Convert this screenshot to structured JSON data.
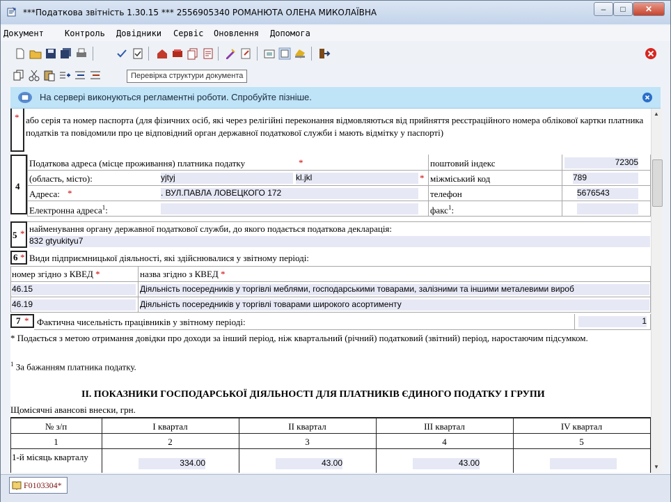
{
  "window": {
    "title": "***Податкова звітність 1.30.15 *** 2556905340 РОМАНЮТА ОЛЕНА МИКОЛАЇВНА",
    "controls": {
      "minimize": "–",
      "maximize": "□",
      "close": "✕"
    }
  },
  "menu": [
    "Документ",
    "Контроль",
    "Довідники",
    "Сервіс",
    "Оновлення",
    "Допомога"
  ],
  "toolbar": {
    "tooltip": "Перевірка структури документа",
    "icons": [
      "new-icon",
      "open-icon",
      "save-icon",
      "save-all-icon",
      "print-icon",
      "check-icon",
      "verify-structure-icon",
      "home-icon",
      "books-icon",
      "copy-doc-icon",
      "report-icon",
      "sign-icon",
      "export-icon",
      "settings-icon",
      "view-icon",
      "help-icon",
      "exit-icon",
      "stop-icon"
    ],
    "row2_icons": [
      "copy-icon",
      "cut-icon",
      "paste-icon",
      "add-row-icon",
      "insert-row-icon",
      "delete-row-icon"
    ]
  },
  "notice": {
    "text": "На сервері виконуються регламентні роботи. Спробуйте пізніше."
  },
  "doc": {
    "passport_note": "або серія та номер паспорта (для фізичних осіб, які через релігійні переконання відмовляються від прийняття реєстраційного номера облікової картки платника податків та повідомили про це відповідний орган державної податкової служби і мають відмітку у паспорті)",
    "s4": {
      "num": "4",
      "address_label": "Податкова адреса (місце проживання) платника податку",
      "region_label": "(область, місто):",
      "region_value": "yjtyj",
      "city_value": "kl.jkl",
      "street_label": "Адреса:",
      "street_value": ". ВУЛ.ПАВЛА ЛОВЕЦКОГО 172",
      "email_label": "Електронна адреса",
      "email_sup": "1",
      "email_value": "",
      "postal_label": "поштовий індекс",
      "postal_value": "72305",
      "intercity_label": "міжміський код",
      "intercity_value": "789",
      "phone_label": "телефон",
      "phone_value": "5676543",
      "fax_label": "факс",
      "fax_sup": "1",
      "fax_value": ""
    },
    "s5": {
      "num": "5",
      "label": "найменування органу державної податкової служби, до якого подається податкова декларація:",
      "value": "832 gtyukityu7"
    },
    "s6": {
      "num": "6",
      "label": "Види підприємницької діяльності, які здійснювалися у звітному періоді:",
      "col_code": "номер згідно з КВЕД",
      "col_name": "назва згідно з КВЕД",
      "rows": [
        {
          "code": "46.15",
          "name": "Діяльність посередників у торгівлі меблями, господарськими товарами, залізними та іншими металевими вироб"
        },
        {
          "code": "46.19",
          "name": "Діяльність посередників у торгівлі товарами широкого асортименту"
        }
      ]
    },
    "s7": {
      "num": "7",
      "label": "Фактична чисельність працівників у звітному періоді:",
      "value": "1"
    },
    "footnote1": "* Подається з метою отримання довідки про доходи за інший період, ніж квартальний (річний) податковий (звітний) період, наростаючим підсумком.",
    "footnote2_sup": "1",
    "footnote2": "За бажанням платника податку.",
    "section2_title": "ІІ. ПОКАЗНИКИ ГОСПОДАРСЬКОЇ ДІЯЛЬНОСТІ ДЛЯ ПЛАТНИКІВ ЄДИНОГО ПОДАТКУ І ГРУПИ",
    "monthly_label": "Щомісячні авансові внески, грн.",
    "table": {
      "headers": [
        "№ з/п",
        "І квартал",
        "ІІ квартал",
        "ІІІ квартал",
        "IV квартал"
      ],
      "nums": [
        "1",
        "2",
        "3",
        "4",
        "5"
      ],
      "row1_label": "1-й місяць кварталу",
      "row1_values": [
        "334.00",
        "43.00",
        "43.00",
        ""
      ]
    }
  },
  "statusbar": {
    "doc_tab": "F0103304*"
  }
}
